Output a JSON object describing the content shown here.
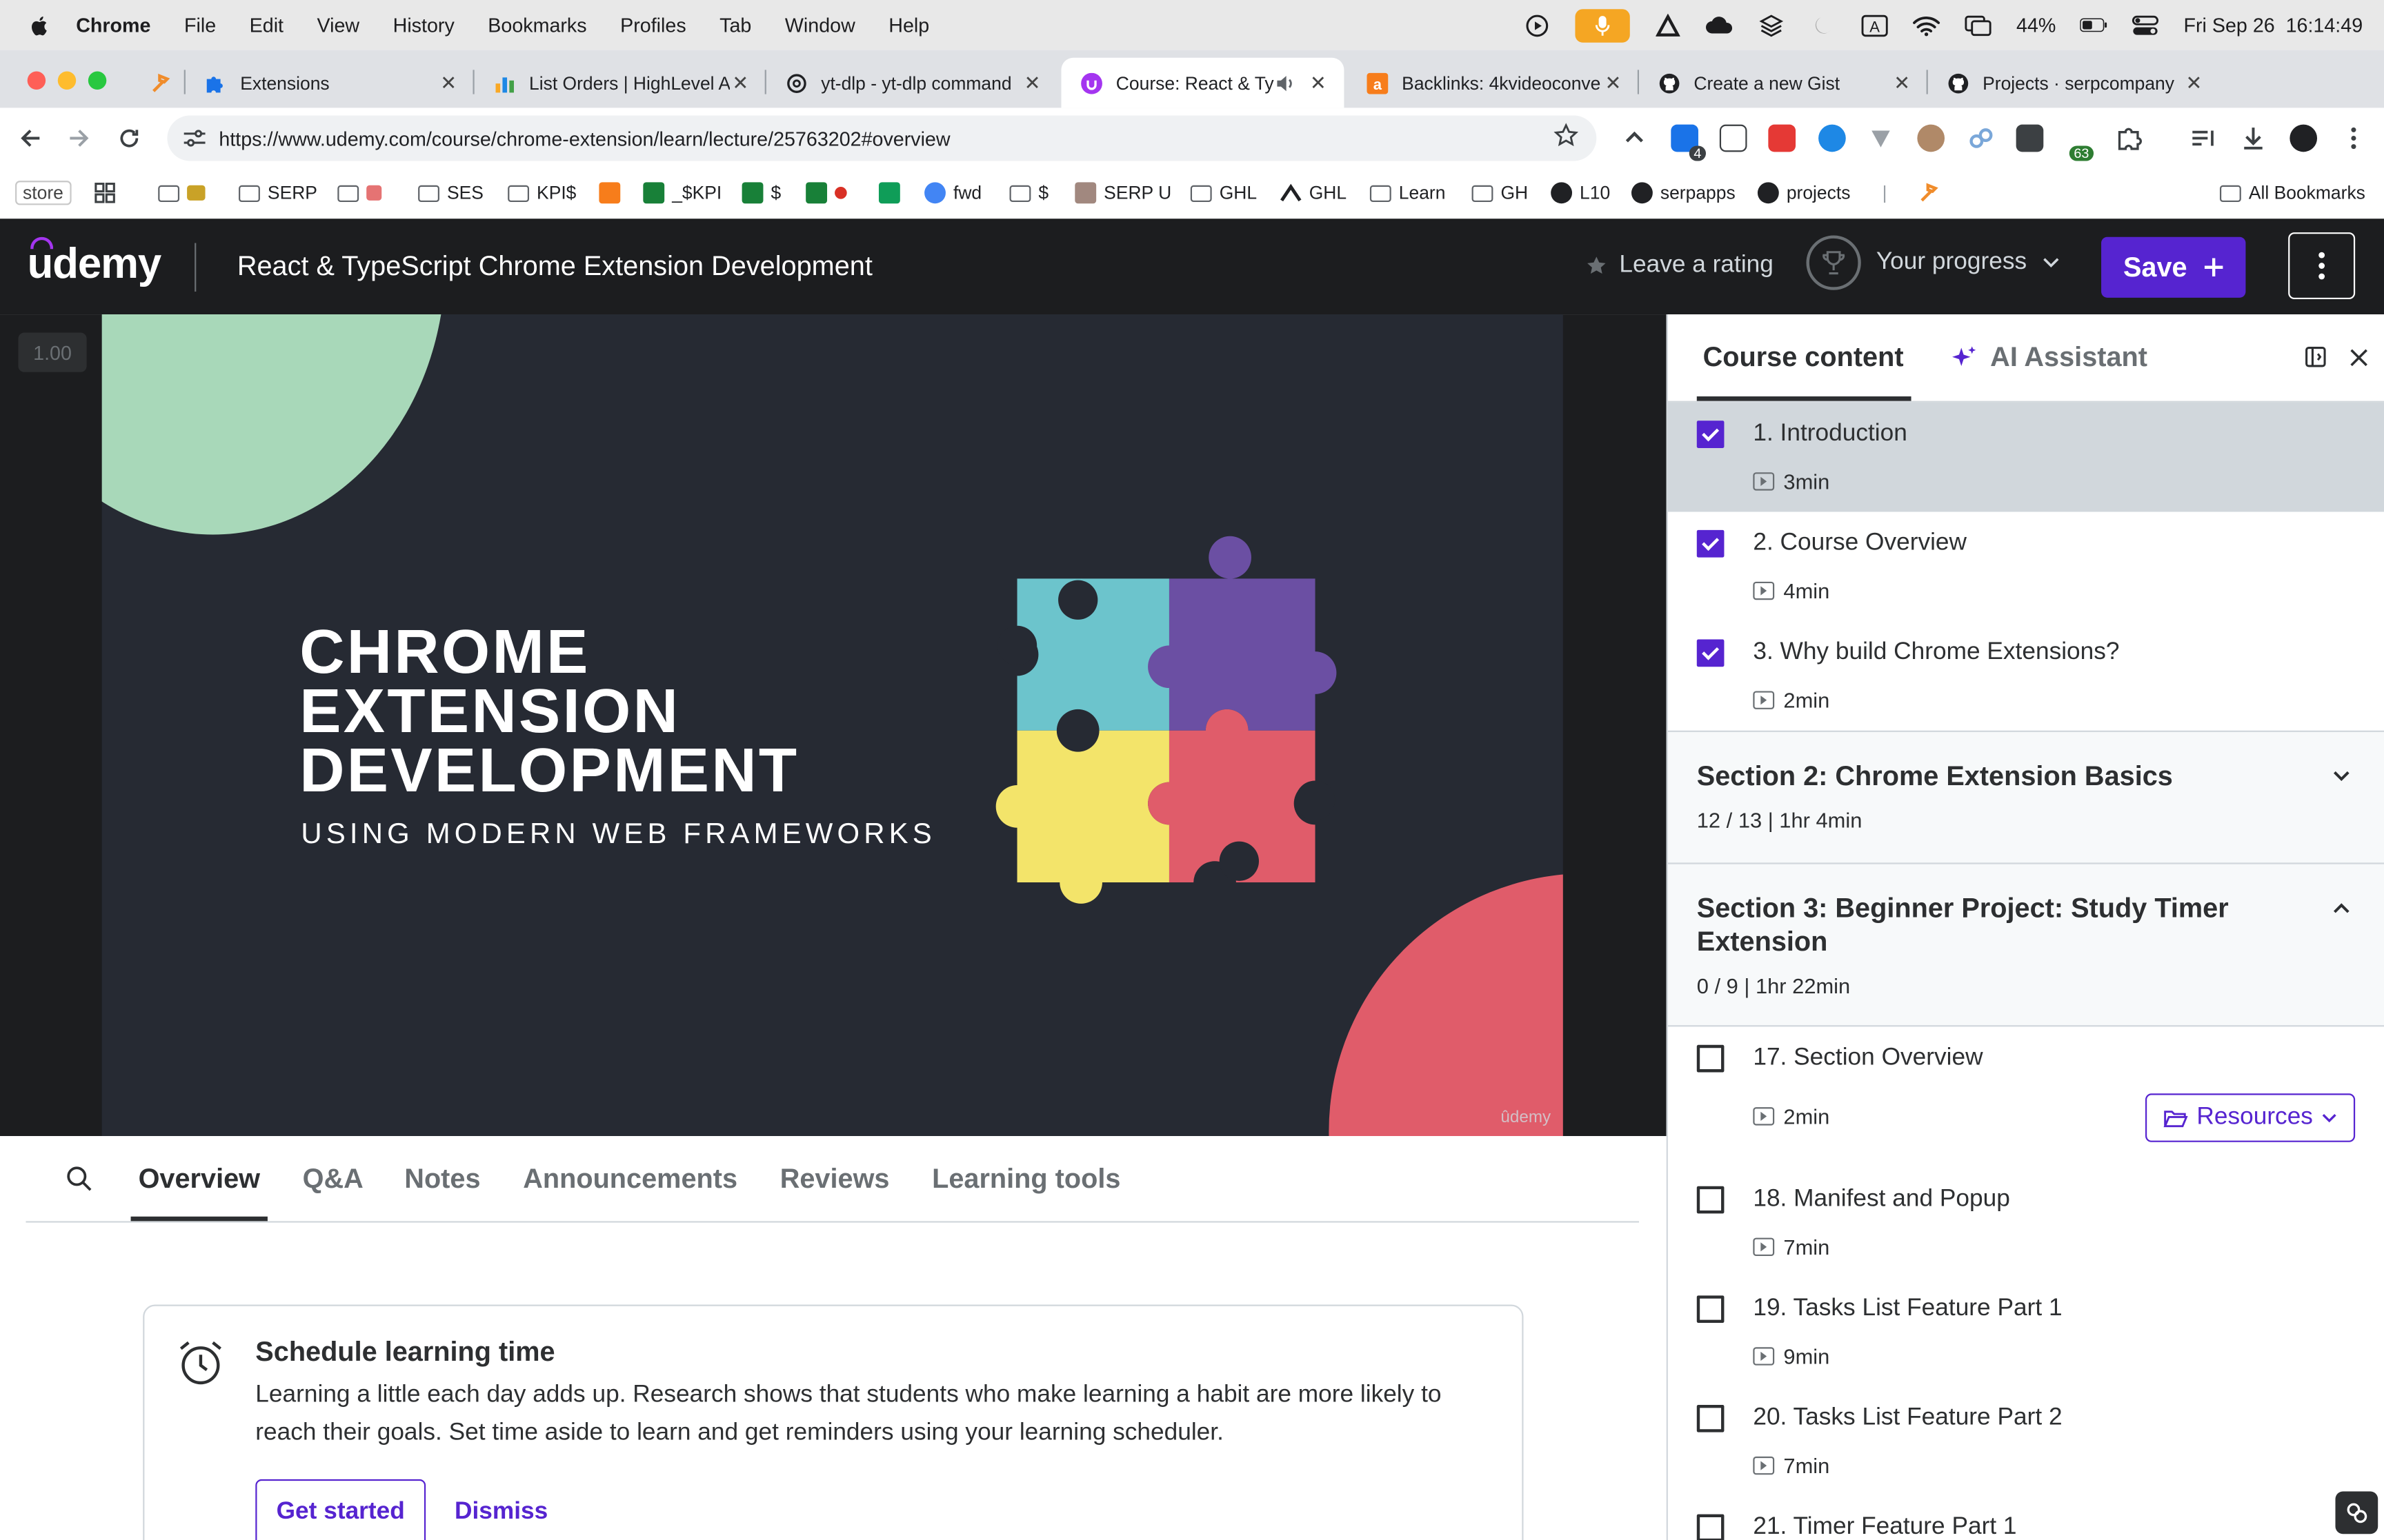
{
  "menubar": {
    "app": "Chrome",
    "items": [
      "File",
      "Edit",
      "View",
      "History",
      "Bookmarks",
      "Profiles",
      "Tab",
      "Window",
      "Help"
    ],
    "battery": "44%",
    "datetime": "Fri Sep 26  16:14:49"
  },
  "tabs": [
    {
      "title": "",
      "icon": "pin-icon"
    },
    {
      "title": "Extensions",
      "icon": "puzzle-icon"
    },
    {
      "title": "List Orders | HighLevel A",
      "icon": "chart-icon"
    },
    {
      "title": "yt-dlp - yt-dlp command",
      "icon": "openai-icon"
    },
    {
      "title": "Course: React & Type",
      "icon": "udemy-icon",
      "active": true
    },
    {
      "title": "Backlinks: 4kvideoconve",
      "icon": "ahrefs-icon"
    },
    {
      "title": "Create a new Gist",
      "icon": "github-icon"
    },
    {
      "title": "Projects · serpcompany",
      "icon": "github-icon"
    }
  ],
  "toolbar": {
    "url": "https://www.udemy.com/course/chrome-extension/learn/lecture/25763202#overview",
    "badge_4": "4",
    "badge_63": "63"
  },
  "bookmarks": [
    "store",
    "SERP",
    "SES",
    "KPI$",
    "_$KPI",
    "$",
    "fwd",
    "$",
    "SERP U",
    "GHL",
    "GHL",
    "Learn",
    "GH",
    "L10",
    "serpapps",
    "projects",
    "All Bookmarks"
  ],
  "udemy": {
    "logo": "udemy",
    "course_title": "React & TypeScript Chrome Extension Development",
    "leave_rating": "Leave a rating",
    "progress": "Your progress",
    "save": "Save"
  },
  "video": {
    "speed": "1.00",
    "title_lines": [
      "CHROME",
      "EXTENSION",
      "DEVELOPMENT"
    ],
    "subtitle": "USING MODERN WEB FRAMEWORKS",
    "watermark": "ûdemy"
  },
  "content_tabs": [
    "Overview",
    "Q&A",
    "Notes",
    "Announcements",
    "Reviews",
    "Learning tools"
  ],
  "schedule": {
    "title": "Schedule learning time",
    "text": "Learning a little each day adds up. Research shows that students who make learning a habit are more likely to reach their goals. Set time aside to learn and get reminders using your learning scheduler.",
    "start": "Get started",
    "dismiss": "Dismiss"
  },
  "sidebar": {
    "tab_content": "Course content",
    "tab_ai": "AI Assistant",
    "lectures_top": [
      {
        "title": "1. Introduction",
        "duration": "3min",
        "checked": true,
        "current": true
      },
      {
        "title": "2. Course Overview",
        "duration": "4min",
        "checked": true
      },
      {
        "title": "3. Why build Chrome Extensions?",
        "duration": "2min",
        "checked": true
      }
    ],
    "section2": {
      "title": "Section 2: Chrome Extension Basics",
      "meta": "12 / 13 | 1hr 4min"
    },
    "section3": {
      "title": "Section 3: Beginner Project: Study Timer Extension",
      "meta": "0 / 9 | 1hr 22min"
    },
    "lectures_s3": [
      {
        "title": "17. Section Overview",
        "duration": "2min",
        "resources": "Resources"
      },
      {
        "title": "18. Manifest and Popup",
        "duration": "7min"
      },
      {
        "title": "19. Tasks List Feature Part 1",
        "duration": "9min"
      },
      {
        "title": "20. Tasks List Feature Part 2",
        "duration": "7min"
      },
      {
        "title": "21. Timer Feature Part 1",
        "duration": ""
      }
    ]
  },
  "colors": {
    "udemy_purple": "#5624d0",
    "header_dark": "#1c1d1f",
    "slide_bg": "#262a33",
    "puzzle_teal": "#6cc4cc",
    "puzzle_purple": "#6b4fa3",
    "puzzle_yellow": "#f3e46a",
    "puzzle_red": "#e05c6a"
  }
}
